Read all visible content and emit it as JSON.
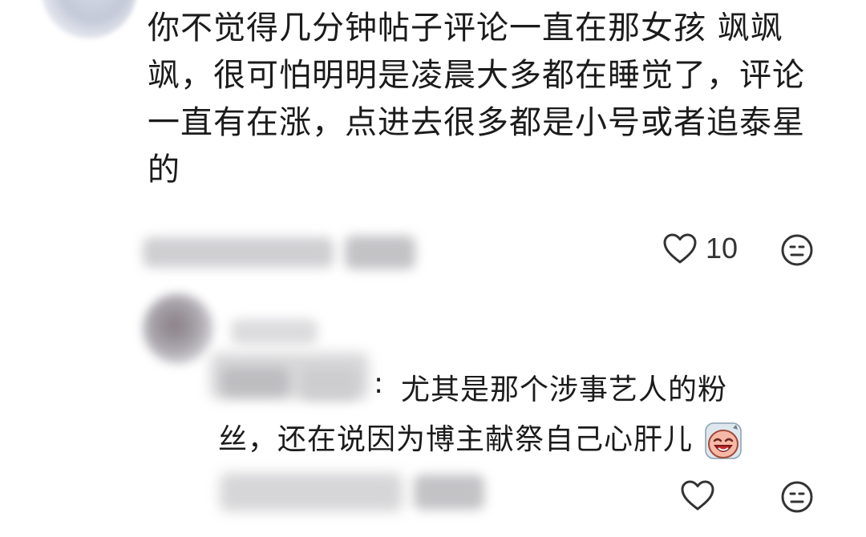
{
  "main_comment": {
    "lines": [
      "你不觉得几分钟帖子评论一直在那女孩 飒飒",
      "飒，很可怕明明是凌晨大多都在睡觉了，评论",
      "一直有在涨，点进去很多都是小号或者追泰星",
      "的"
    ],
    "like_count": "10",
    "icons": [
      "heart-icon",
      "comment-emoji-icon"
    ]
  },
  "reply": {
    "colon": ":",
    "text_line1": "尤其是那个涉事艺人的粉",
    "text_line2": "丝，还在说因为博主献祭自己心肝儿",
    "inline_emoji": "crying-face-icon",
    "icons": [
      "heart-icon",
      "comment-emoji-icon"
    ]
  },
  "colors": {
    "text": "#1b1b1b",
    "icon": "#333333",
    "blur_gray": "#cfcfd2",
    "background": "#ffffff"
  }
}
